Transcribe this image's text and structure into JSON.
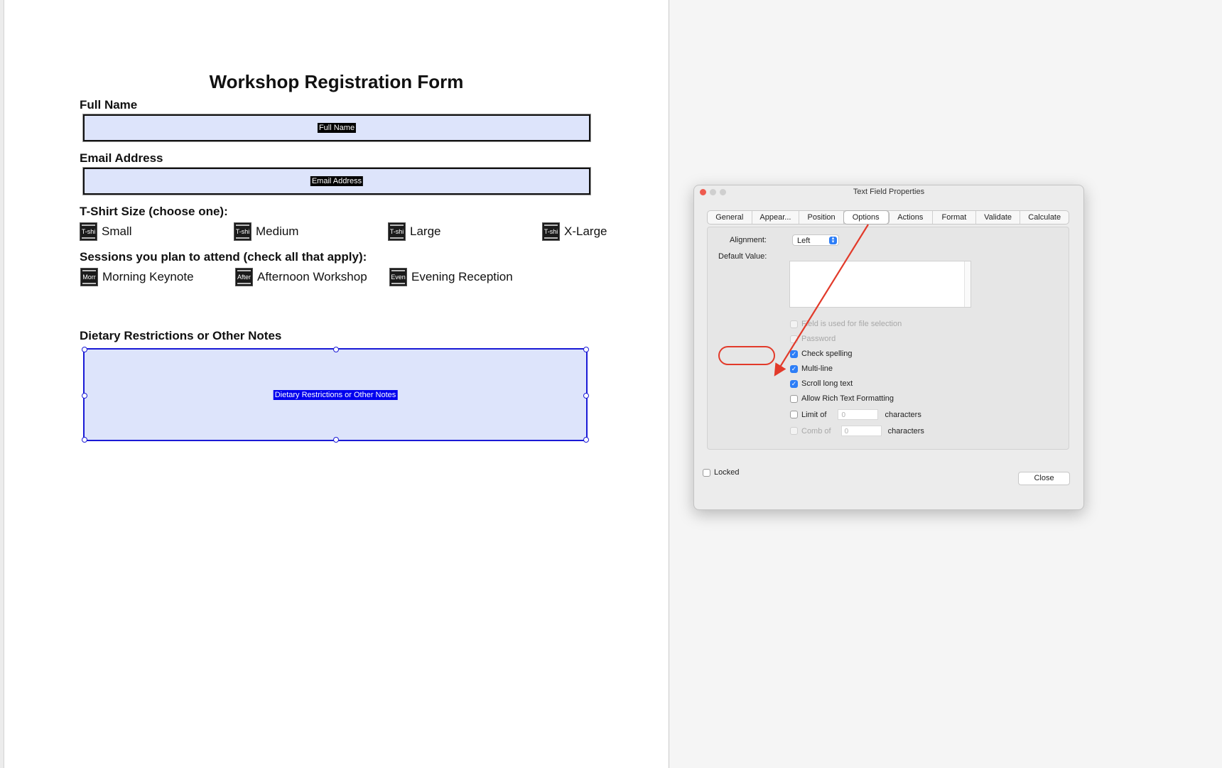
{
  "form": {
    "title": "Workshop Registration Form",
    "full_name_label": "Full Name",
    "full_name_field": "Full Name",
    "email_label": "Email Address",
    "email_field": "Email Address",
    "tshirt_label": "T-Shirt Size (choose one):",
    "tshirt_options": [
      {
        "abbr": "T-shi",
        "label": "Small"
      },
      {
        "abbr": "T-shi",
        "label": "Medium"
      },
      {
        "abbr": "T-shi",
        "label": "Large"
      },
      {
        "abbr": "T-shi",
        "label": "X-Large"
      }
    ],
    "sessions_label": "Sessions you plan to attend (check all that apply):",
    "session_options": [
      {
        "abbr": "Morr",
        "label": "Morning Keynote"
      },
      {
        "abbr": "After",
        "label": "Afternoon Workshop"
      },
      {
        "abbr": "Even",
        "label": "Evening Reception"
      }
    ],
    "notes_label": "Dietary Restrictions or Other Notes",
    "notes_field": "Dietary Restrictions or Other Notes"
  },
  "dialog": {
    "title": "Text Field Properties",
    "tabs": [
      "General",
      "Appear...",
      "Position",
      "Options",
      "Actions",
      "Format",
      "Validate",
      "Calculate"
    ],
    "active_tab": "Options",
    "alignment_label": "Alignment:",
    "alignment_value": "Left",
    "default_value_label": "Default Value:",
    "options": [
      {
        "label": "Field is used for file selection",
        "checked": false,
        "enabled": false
      },
      {
        "label": "Password",
        "checked": false,
        "enabled": false
      },
      {
        "label": "Check spelling",
        "checked": true,
        "enabled": true
      },
      {
        "label": "Multi-line",
        "checked": true,
        "enabled": true
      },
      {
        "label": "Scroll long text",
        "checked": true,
        "enabled": true
      },
      {
        "label": "Allow Rich Text Formatting",
        "checked": false,
        "enabled": true
      }
    ],
    "limit_label": "Limit of",
    "limit_value": "0",
    "limit_suffix": "characters",
    "comb_label": "Comb of",
    "comb_value": "0",
    "comb_suffix": "characters",
    "locked_label": "Locked",
    "close_label": "Close"
  },
  "annotation": {
    "color": "#e23a2a",
    "target": "Multi-line"
  }
}
